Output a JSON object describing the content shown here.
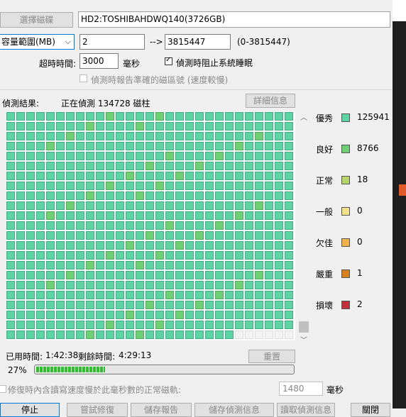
{
  "drive": {
    "select_button": "選擇磁碟",
    "name": "HD2:TOSHIBAHDWQ140(3726GB)"
  },
  "range": {
    "mode": "容量範圍(MB)",
    "start": "2",
    "arrow": "-->",
    "end": "3815447",
    "limits": "(0-3815447)"
  },
  "timeout": {
    "label": "超時時間:",
    "value": "3000",
    "unit": "毫秒",
    "prevent_sleep_label": "偵測時阻止系統睡眠",
    "prevent_sleep_checked": true,
    "report_sector_label": "偵測時報告準確的磁區號 (速度較慢)",
    "report_sector_checked": false
  },
  "results": {
    "label": "偵測結果:",
    "status": "正在偵測 134728 磁柱",
    "details_button": "詳細信息"
  },
  "legend": [
    {
      "label": "優秀",
      "color": "#5ed3a4",
      "count": "125941"
    },
    {
      "label": "良好",
      "color": "#6fcf74",
      "count": "8766"
    },
    {
      "label": "正常",
      "color": "#b6d46a",
      "count": "18"
    },
    {
      "label": "一般",
      "color": "#f3e08a",
      "count": "0"
    },
    {
      "label": "欠佳",
      "color": "#f2b24a",
      "count": "0"
    },
    {
      "label": "嚴重",
      "color": "#d6801c",
      "count": "1"
    },
    {
      "label": "損壞",
      "color": "#c0303a",
      "count": "2"
    }
  ],
  "time": {
    "elapsed_label": "已用時間:",
    "elapsed": "1:42:38",
    "remaining_label": "剩餘時間:",
    "remaining": "4:29:13",
    "reset_button": "重置"
  },
  "progress": {
    "percent_text": "27%",
    "fraction": 0.27
  },
  "repair": {
    "label": "修復時內含讀寫速度慢於此毫秒數的正常磁軌:",
    "value": "1480",
    "unit": "毫秒"
  },
  "bottom_buttons": [
    "停止",
    "嘗試修復",
    "儲存報告",
    "儲存偵測信息",
    "讀取偵測信息",
    "關閉"
  ],
  "colors": {
    "excellent": "#5ed3a4",
    "good": "#6fcf74",
    "progress": "#2fbf2f"
  }
}
